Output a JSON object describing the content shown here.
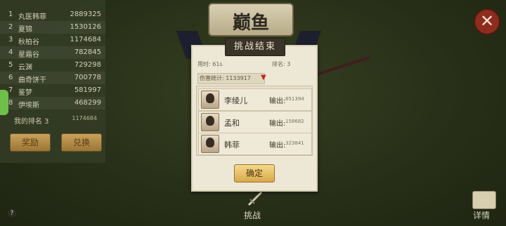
{
  "title": "巅鱼",
  "ranking": {
    "rows": [
      {
        "rank": "1",
        "name": "丸医韩菲",
        "score": "2889325"
      },
      {
        "rank": "2",
        "name": "夏锦",
        "score": "1530126"
      },
      {
        "rank": "3",
        "name": "秋柏谷",
        "score": "1174684"
      },
      {
        "rank": "4",
        "name": "星霜谷",
        "score": "782845"
      },
      {
        "rank": "5",
        "name": "云渊",
        "score": "729298"
      },
      {
        "rank": "6",
        "name": "曲奇饼干",
        "score": "700778"
      },
      {
        "rank": "7",
        "name": "鉴梦",
        "score": "581997"
      },
      {
        "rank": "8",
        "name": "伊埃斯",
        "score": "468299"
      }
    ],
    "my_rank_label": "我的排名 3",
    "my_score": "1174684",
    "reward_label": "奖励",
    "exchange_label": "兑换"
  },
  "dialog": {
    "header": "挑战结束",
    "time_label": "用时: 61s",
    "rank_label": "排名: 3",
    "damage_label": "伤害统计: 1133917",
    "members": [
      {
        "name": "李绫儿",
        "out_label": "输出:",
        "out_value": "651394"
      },
      {
        "name": "孟和",
        "out_label": "输出:",
        "out_value": "158682"
      },
      {
        "name": "韩菲",
        "out_label": "输出:",
        "out_value": "323841"
      }
    ],
    "confirm_label": "确定"
  },
  "bottom": {
    "challenge_label": "挑战",
    "detail_label": "详情"
  },
  "close_glyph": "✕",
  "help_glyph": "?"
}
